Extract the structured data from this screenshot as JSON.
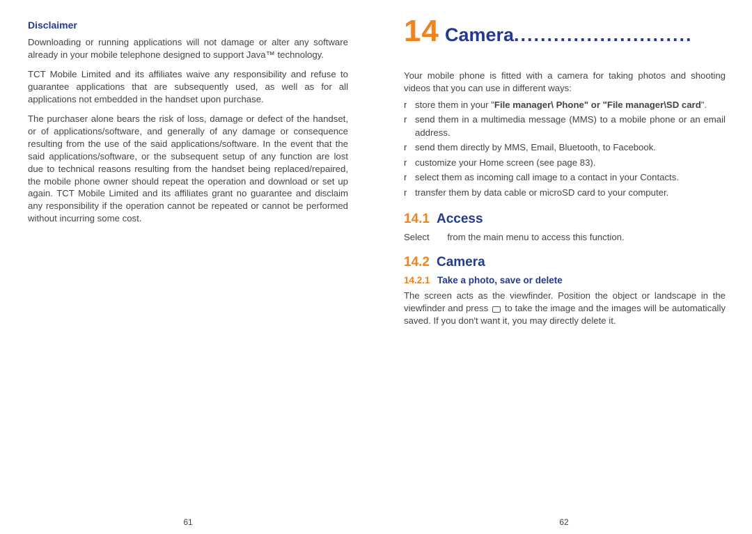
{
  "left": {
    "disclaimer_title": "Disclaimer",
    "p1": "Downloading or running applications will not damage or alter any software already in your mobile telephone designed to support Java™ technology.",
    "p2": "TCT Mobile Limited and its affiliates waive any responsibility and refuse to guarantee applications that are subsequently used, as well as for all applications not embedded in the handset upon purchase.",
    "p3": "The purchaser alone bears the risk of loss, damage or defect of the handset, or of applications/software, and generally of any damage or consequence resulting from the use of the said applications/software. In the event that the said applications/software, or the subsequent setup of any function are lost due to technical reasons resulting from the handset being replaced/repaired, the mobile phone owner should repeat the operation and download or set up again. TCT Mobile Limited and its affiliates grant no guarantee and disclaim any responsibility if the operation cannot be repeated or cannot be performed without incurring some cost.",
    "pagenum": "61"
  },
  "right": {
    "ch_num": "14",
    "ch_name": "Camera",
    "ch_dots": "...........................",
    "intro": "Your mobile phone is fitted with a camera for taking photos and shooting videos that you can use in different ways:",
    "ways": [
      {
        "pre": "store them in your \"",
        "bold": "File manager\\ Phone\" or \"File manager\\SD card",
        "post": "\"."
      },
      {
        "pre": "send them in a multimedia message (MMS) to a mobile phone or an email address.",
        "bold": "",
        "post": ""
      },
      {
        "pre": "send them directly by MMS, Email, Bluetooth, to Facebook.",
        "bold": "",
        "post": ""
      },
      {
        "pre": "customize your Home screen (see page 83).",
        "bold": "",
        "post": ""
      },
      {
        "pre": "select them as incoming call image to a contact in your Contacts.",
        "bold": "",
        "post": ""
      },
      {
        "pre": "transfer them by data cable or microSD card to your computer.",
        "bold": "",
        "post": ""
      }
    ],
    "s1_num": "14.1",
    "s1_name": "Access",
    "s1_body_a": "Select",
    "s1_body_b": "from the main menu to access this function.",
    "s2_num": "14.2",
    "s2_name": "Camera",
    "s2_1_num": "14.2.1",
    "s2_1_name": "Take a photo, save or delete",
    "s2_1_body_a": "The screen acts as the viewfinder. Position the object or landscape in the viewfinder and press",
    "s2_1_body_b": "to take the image and the images will be automatically saved. If you don't want it, you may directly delete it.",
    "pagenum": "62"
  }
}
